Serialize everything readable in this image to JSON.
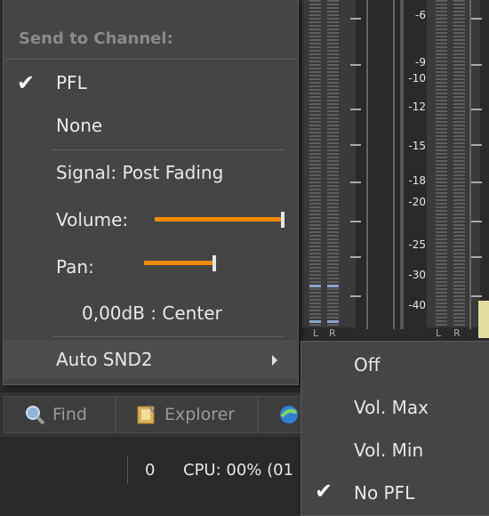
{
  "meters": {
    "db_labels": [
      "-6",
      "-9",
      "-10",
      "-12",
      "-15",
      "-18",
      "-20",
      "-25",
      "-30",
      "-40"
    ],
    "left_meter_channels": [
      "L",
      "R"
    ],
    "right_meter_channels": [
      "L",
      "R"
    ]
  },
  "menu": {
    "header": "Send to Channel:",
    "items": {
      "pfl": "PFL",
      "none": "None",
      "signal": "Signal: Post Fading",
      "volume_label": "Volume:",
      "pan_label": "Pan:",
      "pan_value": "0,00dB : Center",
      "auto_snd2": "Auto SND2"
    },
    "pfl_checked": true,
    "volume_level": 1.0,
    "pan_level": 0.5
  },
  "submenu": {
    "items": [
      "Off",
      "Vol. Max",
      "Vol. Min",
      "No PFL"
    ],
    "checked_index": 3
  },
  "toolbar": {
    "find_label": "Find",
    "explorer_label": "Explorer"
  },
  "status": {
    "count": "0",
    "cpu": "CPU: 00% (01"
  },
  "colors": {
    "accent": "#f08a00",
    "menu_bg": "#454545",
    "meter_highlight": "#8aa6c8"
  }
}
